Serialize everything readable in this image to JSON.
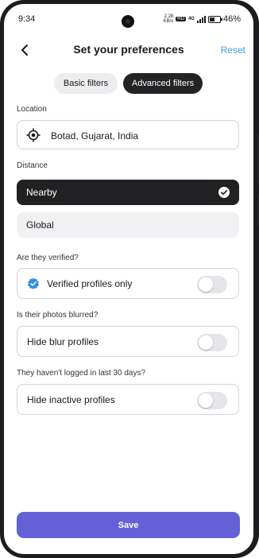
{
  "status_bar": {
    "time": "9:34",
    "net_speed_value": "2.28",
    "net_speed_unit": "KB/s",
    "hd_badge": "HD",
    "network": "4G",
    "battery_percent": "46%",
    "battery_level": 0.46
  },
  "header": {
    "title": "Set your preferences",
    "reset_label": "Reset",
    "back_icon": "chevron-left-icon"
  },
  "filter_tabs": {
    "basic_label": "Basic filters",
    "advanced_label": "Advanced filters",
    "active": "advanced"
  },
  "location": {
    "label": "Location",
    "value": "Botad, Gujarat, India",
    "icon": "location-target-icon"
  },
  "distance": {
    "label": "Distance",
    "options": [
      {
        "label": "Nearby",
        "selected": true
      },
      {
        "label": "Global",
        "selected": false
      }
    ]
  },
  "verified": {
    "question": "Are they verified?",
    "option_label": "Verified profiles only",
    "icon": "verified-badge-icon",
    "enabled": false
  },
  "blurred": {
    "question": "Is their photos blurred?",
    "option_label": "Hide blur profiles",
    "enabled": false
  },
  "inactive": {
    "question": "They haven't logged in last 30 days?",
    "option_label": "Hide inactive profiles",
    "enabled": false
  },
  "footer": {
    "save_label": "Save"
  },
  "colors": {
    "accent": "#6461d6",
    "link": "#3b9be8",
    "selected_bg": "#212124",
    "verified_blue": "#2f8fe6"
  }
}
